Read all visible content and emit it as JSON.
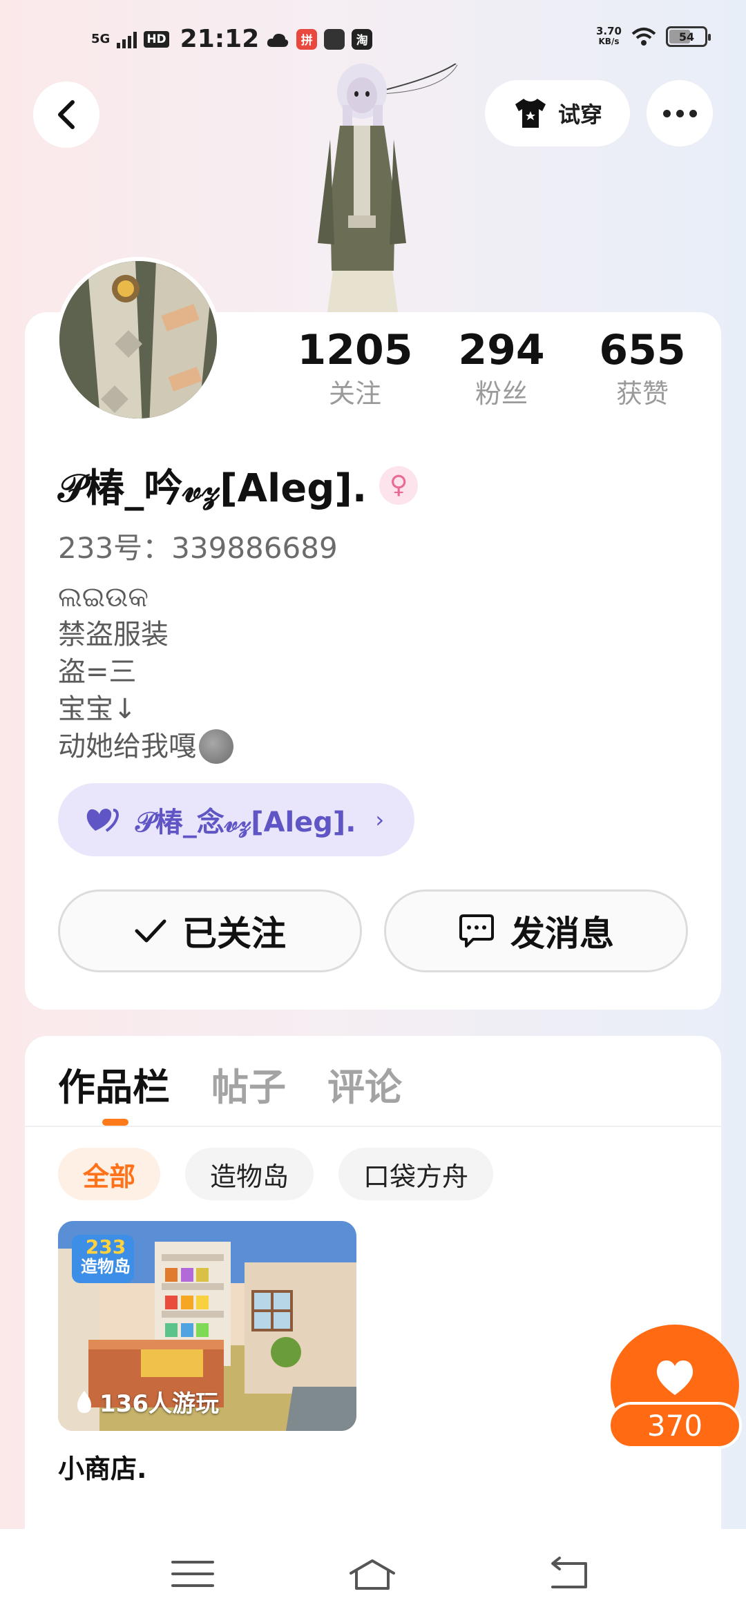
{
  "status_bar": {
    "network": "5G",
    "hd": "HD",
    "time": "21:12",
    "apps": [
      "cloud-icon",
      "pdd-icon",
      "app-icon",
      "taobao-icon"
    ],
    "taobao_label": "淘",
    "pdd_label": "拼",
    "speed_value": "3.70",
    "speed_unit": "KB/s",
    "battery": "54"
  },
  "header": {
    "tryon_label": "试穿"
  },
  "stats": [
    {
      "value": "1205",
      "label": "关注"
    },
    {
      "value": "294",
      "label": "粉丝"
    },
    {
      "value": "655",
      "label": "获赞"
    }
  ],
  "profile": {
    "nickname": "𝒫椿_吟𝓋𝓏[Aleg].",
    "uid": "233号：339886689",
    "bio": [
      "ଲଇଉକ",
      "禁盗服装",
      "盗=三",
      "宝宝↓",
      "动她给我嘎"
    ],
    "cp_name": "𝒫椿_念𝓋𝓏[Aleg].",
    "follow_label": "已关注",
    "message_label": "发消息"
  },
  "works": {
    "tabs": [
      "作品栏",
      "帖子",
      "评论"
    ],
    "filters": [
      "全部",
      "造物岛",
      "口袋方舟"
    ],
    "game": {
      "players": "136人游玩",
      "title": "小商店.",
      "badge_top": "233",
      "badge_bottom": "造物岛"
    },
    "like_count": "370"
  },
  "colors": {
    "accent": "#ff6a13",
    "cp_bg": "#e9e6fb",
    "cp_text": "#5f55c4"
  }
}
